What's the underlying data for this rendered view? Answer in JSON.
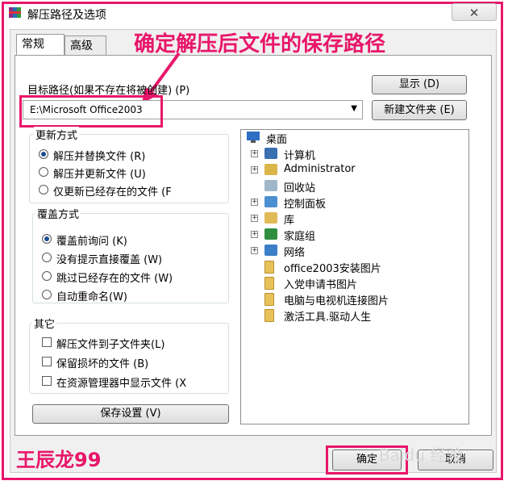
{
  "window": {
    "title": "解压路径及选项",
    "close_glyph": "✕",
    "app_icon": "winrar-icon"
  },
  "tabs": [
    {
      "label": "常规"
    },
    {
      "label": "高级"
    }
  ],
  "annotation": "确定解压后文件的保存路径",
  "target": {
    "label": "目标路径(如果不存在将被创建) (P)",
    "value": "E:\\Microsoft Office2003",
    "dropdown_glyph": "▼"
  },
  "buttons": {
    "show": "显示 (D)",
    "new_folder": "新建文件夹 (E)",
    "save_settings": "保存设置 (V)",
    "ok": "确定",
    "cancel": "取消"
  },
  "update_mode": {
    "title": "更新方式",
    "options": [
      {
        "label": "解压并替换文件 (R)",
        "checked": true
      },
      {
        "label": "解压并更新文件 (U)",
        "checked": false
      },
      {
        "label": "仅更新已经存在的文件 (F",
        "checked": false
      }
    ]
  },
  "overwrite_mode": {
    "title": "覆盖方式",
    "options": [
      {
        "label": "覆盖前询问 (K)",
        "checked": true
      },
      {
        "label": "没有提示直接覆盖 (W)",
        "checked": false
      },
      {
        "label": "跳过已经存在的文件 (W)",
        "checked": false
      },
      {
        "label": "自动重命名(W)",
        "checked": false
      }
    ]
  },
  "misc": {
    "title": "其它",
    "options": [
      {
        "label": "解压文件到子文件夹(L)",
        "checked": false
      },
      {
        "label": "保留损坏的文件 (B)",
        "checked": false
      },
      {
        "label": "在资源管理器中显示文件 (X",
        "checked": false
      }
    ]
  },
  "tree": {
    "root": {
      "label": "桌面",
      "icon": "desktop-icon"
    },
    "items": [
      {
        "label": "计算机",
        "icon": "computer-icon",
        "expandable": true
      },
      {
        "label": "Administrator",
        "icon": "user-folder-icon",
        "expandable": true
      },
      {
        "label": "回收站",
        "icon": "recycle-bin-icon",
        "expandable": false
      },
      {
        "label": "控制面板",
        "icon": "control-panel-icon",
        "expandable": true
      },
      {
        "label": "库",
        "icon": "library-icon",
        "expandable": true
      },
      {
        "label": "家庭组",
        "icon": "homegroup-icon",
        "expandable": true
      },
      {
        "label": "网络",
        "icon": "network-icon",
        "expandable": true
      },
      {
        "label": "office2003安装图片",
        "icon": "folder-icon",
        "expandable": false
      },
      {
        "label": "入党申请书图片",
        "icon": "folder-icon",
        "expandable": false
      },
      {
        "label": "电脑与电视机连接图片",
        "icon": "folder-icon",
        "expandable": false
      },
      {
        "label": "激活工具.驱动人生",
        "icon": "folder-icon",
        "expandable": false
      }
    ]
  },
  "watermark": "王辰龙99",
  "baidu_mark": "Baidu 经验",
  "colors": {
    "annotation": "#e8166a",
    "dialog_bg": "#f0f0f0",
    "radio_dot": "#1d4f91",
    "folder": "#e8c15a"
  }
}
